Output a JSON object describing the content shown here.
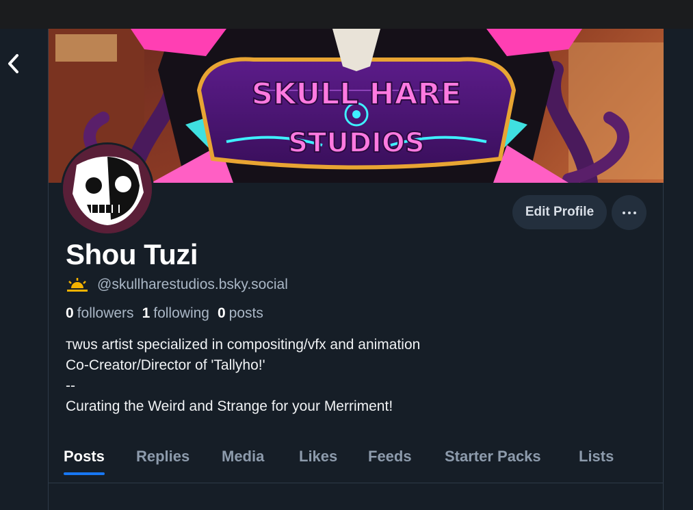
{
  "profile": {
    "display_name": "Shou Tuzi",
    "handle": "@skullharestudios.bsky.social",
    "handle_icon": "sun-rise-icon",
    "followers_count": "0",
    "followers_label": "followers",
    "following_count": "1",
    "following_label": "following",
    "posts_count": "0",
    "posts_label": "posts",
    "bio_lines": [
      "ᴛᴡᴜs artist specialized in compositing/vfx and animation",
      "Co-Creator/Director of 'Tallyho!'",
      "--",
      "Curating the Weird and Strange for your Merriment!"
    ]
  },
  "banner": {
    "logo_line1": "SKULL HARE",
    "logo_line2": "STUDIOS"
  },
  "actions": {
    "edit_label": "Edit Profile",
    "more_icon": "more-dots-icon",
    "back_icon": "chevron-left-icon"
  },
  "tabs": [
    {
      "label": "Posts",
      "active": true
    },
    {
      "label": "Replies",
      "active": false
    },
    {
      "label": "Media",
      "active": false
    },
    {
      "label": "Likes",
      "active": false
    },
    {
      "label": "Feeds",
      "active": false
    },
    {
      "label": "Starter Packs",
      "active": false
    },
    {
      "label": "Lists",
      "active": false
    }
  ],
  "colors": {
    "background": "#161e27",
    "accent": "#1877f2",
    "muted_text": "#aab7c6",
    "button_bg": "#232f3d"
  }
}
